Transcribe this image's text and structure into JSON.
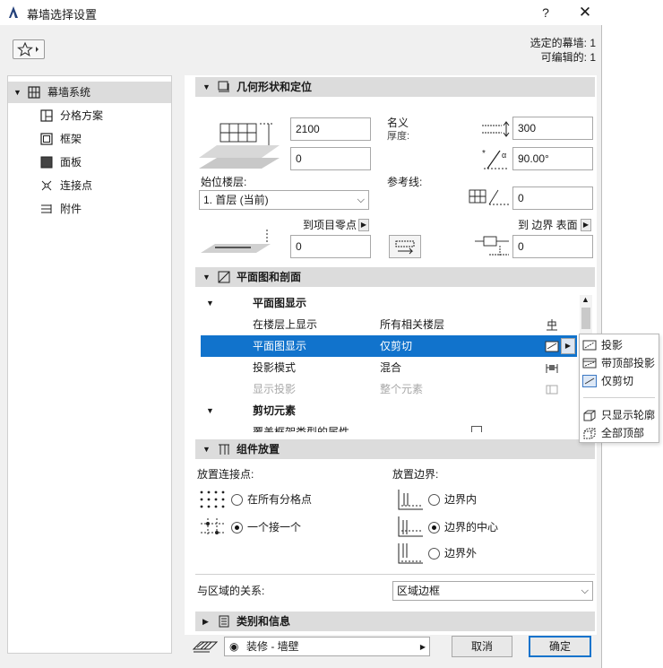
{
  "window": {
    "title": "幕墙选择设置",
    "help": "?",
    "close": "✕"
  },
  "selection_info": {
    "selected": "选定的幕墙: 1",
    "editable": "可编辑的: 1"
  },
  "sidebar": {
    "items": [
      {
        "label": "幕墙系统",
        "icon": "curtain-wall-icon"
      },
      {
        "label": "分格方案",
        "icon": "scheme-icon"
      },
      {
        "label": "框架",
        "icon": "frame-icon"
      },
      {
        "label": "面板",
        "icon": "panel-icon"
      },
      {
        "label": "连接点",
        "icon": "junction-icon"
      },
      {
        "label": "附件",
        "icon": "accessory-icon"
      }
    ]
  },
  "geometry": {
    "header": "几何形状和定位",
    "height_value": "2100",
    "offset_value": "0",
    "home_story_label": "始位楼层:",
    "home_story_value": "1. 首层 (当前)",
    "to_project_zero_label": "到项目零点",
    "project_zero_value": "0",
    "nominal_label": "名义",
    "thickness_label": "厚度:",
    "thickness_value": "300",
    "angle_value": "90.00°",
    "reference_line_label": "参考线:",
    "reference_offset_value": "0",
    "to_boundary_label": "到 边界 表面",
    "boundary_value": "0"
  },
  "floorplan": {
    "header": "平面图和剖面",
    "groups": [
      {
        "label": "平面图显示",
        "rows": [
          {
            "name": "在楼层上显示",
            "value": "所有相关楼层",
            "state": "normal"
          },
          {
            "name": "平面图显示",
            "value": "仅剪切",
            "state": "highlight"
          },
          {
            "name": "投影模式",
            "value": "混合",
            "state": "normal"
          },
          {
            "name": "显示投影",
            "value": "整个元素",
            "state": "disabled"
          }
        ]
      },
      {
        "label": "剪切元素",
        "rows": [
          {
            "name": "覆盖框架类型的属性",
            "value": "",
            "state": "normal"
          }
        ]
      }
    ]
  },
  "popup_menu": {
    "items": [
      "投影",
      "带顶部投影",
      "仅剪切"
    ],
    "items2": [
      "只显示轮廓",
      "全部顶部"
    ]
  },
  "placement": {
    "header": "组件放置",
    "junction_label": "放置连接点:",
    "junction_options": [
      "在所有分格点",
      "一个接一个"
    ],
    "junction_selected": 1,
    "boundary_label": "放置边界:",
    "boundary_options": [
      "边界内",
      "边界的中心",
      "边界外"
    ],
    "boundary_selected": 1,
    "zone_label": "与区域的关系:",
    "zone_value": "区域边框"
  },
  "category": {
    "header": "类别和信息"
  },
  "footer": {
    "layer_value": "装修 - 墙壁",
    "cancel": "取消",
    "ok": "确定"
  }
}
